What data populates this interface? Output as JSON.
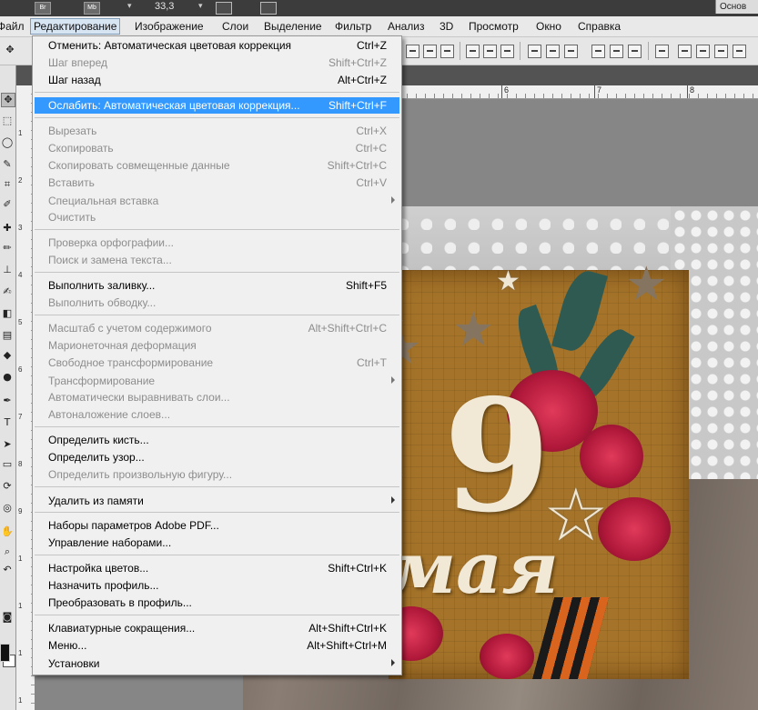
{
  "appbar": {
    "badges": [
      "Br",
      "Mb"
    ],
    "zoom": "33,3",
    "workspace": "Основ"
  },
  "menubar": {
    "items": [
      "Файл",
      "Редактирование",
      "Изображение",
      "Слои",
      "Выделение",
      "Фильтр",
      "Анализ",
      "3D",
      "Просмотр",
      "Окно",
      "Справка"
    ],
    "active": "Редактирование"
  },
  "ruler": {
    "h": [
      "6",
      "7",
      "8"
    ],
    "v": [
      "1",
      "2",
      "3",
      "4",
      "5",
      "6",
      "7",
      "8",
      "9",
      "1",
      "1",
      "1",
      "1"
    ]
  },
  "tools": {
    "icons": [
      "move-icon",
      "marquee-icon",
      "lasso-icon",
      "quick-select-icon",
      "crop-icon",
      "eyedropper-icon",
      "healing-icon",
      "brush-icon",
      "stamp-icon",
      "history-brush-icon",
      "eraser-icon",
      "gradient-icon",
      "blur-icon",
      "dodge-icon",
      "pen-icon",
      "type-icon",
      "path-select-icon",
      "shape-icon",
      "3d-rotate-icon",
      "3d-orbit-icon",
      "hand-icon",
      "zoom-icon"
    ],
    "foreground": "#111111",
    "background": "#ffffff"
  },
  "edit_menu": {
    "items": [
      {
        "label": "Отменить: Автоматическая цветовая коррекция",
        "shortcut": "Ctrl+Z",
        "disabled": false
      },
      {
        "label": "Шаг вперед",
        "shortcut": "Shift+Ctrl+Z",
        "disabled": true
      },
      {
        "label": "Шаг назад",
        "shortcut": "Alt+Ctrl+Z",
        "disabled": false
      },
      {
        "label": "Ослабить: Автоматическая цветовая коррекция...",
        "shortcut": "Shift+Ctrl+F",
        "disabled": false,
        "highlighted": true
      },
      {
        "label": "Вырезать",
        "shortcut": "Ctrl+X",
        "disabled": true
      },
      {
        "label": "Скопировать",
        "shortcut": "Ctrl+C",
        "disabled": true
      },
      {
        "label": "Скопировать совмещенные данные",
        "shortcut": "Shift+Ctrl+C",
        "disabled": true
      },
      {
        "label": "Вставить",
        "shortcut": "Ctrl+V",
        "disabled": true
      },
      {
        "label": "Специальная вставка",
        "shortcut": "",
        "disabled": true,
        "submenu": true
      },
      {
        "label": "Очистить",
        "shortcut": "",
        "disabled": true
      },
      {
        "label": "Проверка орфографии...",
        "shortcut": "",
        "disabled": true
      },
      {
        "label": "Поиск и замена текста...",
        "shortcut": "",
        "disabled": true
      },
      {
        "label": "Выполнить заливку...",
        "shortcut": "Shift+F5",
        "disabled": false
      },
      {
        "label": "Выполнить обводку...",
        "shortcut": "",
        "disabled": true
      },
      {
        "label": "Масштаб с учетом содержимого",
        "shortcut": "Alt+Shift+Ctrl+C",
        "disabled": true
      },
      {
        "label": "Марионеточная деформация",
        "shortcut": "",
        "disabled": true
      },
      {
        "label": "Свободное трансформирование",
        "shortcut": "Ctrl+T",
        "disabled": true
      },
      {
        "label": "Трансформирование",
        "shortcut": "",
        "disabled": true,
        "submenu": true
      },
      {
        "label": "Автоматически выравнивать слои...",
        "shortcut": "",
        "disabled": true
      },
      {
        "label": "Автоналожение слоев...",
        "shortcut": "",
        "disabled": true
      },
      {
        "label": "Определить кисть...",
        "shortcut": "",
        "disabled": false
      },
      {
        "label": "Определить узор...",
        "shortcut": "",
        "disabled": false
      },
      {
        "label": "Определить произвольную фигуру...",
        "shortcut": "",
        "disabled": true
      },
      {
        "label": "Удалить из памяти",
        "shortcut": "",
        "disabled": false,
        "submenu": true
      },
      {
        "label": "Наборы параметров Adobe PDF...",
        "shortcut": "",
        "disabled": false
      },
      {
        "label": "Управление наборами...",
        "shortcut": "",
        "disabled": false
      },
      {
        "label": "Настройка цветов...",
        "shortcut": "Shift+Ctrl+K",
        "disabled": false
      },
      {
        "label": "Назначить профиль...",
        "shortcut": "",
        "disabled": false
      },
      {
        "label": "Преобразовать в профиль...",
        "shortcut": "",
        "disabled": false
      },
      {
        "label": "Клавиатурные сокращения...",
        "shortcut": "Alt+Shift+Ctrl+K",
        "disabled": false
      },
      {
        "label": "Меню...",
        "shortcut": "Alt+Shift+Ctrl+M",
        "disabled": false
      },
      {
        "label": "Установки",
        "shortcut": "",
        "disabled": false,
        "submenu": true
      }
    ]
  },
  "artwork": {
    "nine": "9",
    "may": "мая"
  },
  "colors": {
    "highlight": "#3399ff",
    "menu_bg": "#f0f0f0",
    "disabled_text": "#8d8d8d"
  }
}
